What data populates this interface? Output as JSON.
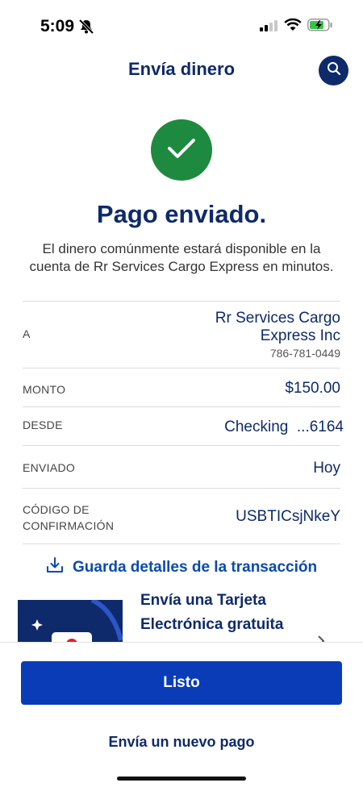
{
  "status": {
    "time": "5:09"
  },
  "header": {
    "title": "Envía dinero"
  },
  "confirmation": {
    "title": "Pago enviado.",
    "message": "El dinero comúnmente estará disponible en la cuenta de Rr Services Cargo Express en minutos."
  },
  "details": {
    "a_label": "A",
    "recipient_line1": "Rr Services Cargo",
    "recipient_line2": "Express Inc",
    "recipient_phone": "786-781-0449",
    "monto_label": "MONTO",
    "monto_value": "$150.00",
    "desde_label": "DESDE",
    "desde_value": "Checking  ...6164",
    "enviado_label": "ENVIADO",
    "enviado_value": "Hoy",
    "codigo_label_1": "CÓDIGO DE",
    "codigo_label_2": "CONFIRMACIÓN",
    "codigo_value": "USBTICsjNkeY"
  },
  "save_link": "Guarda detalles de la transacción",
  "promo": {
    "line1": "Envía una Tarjeta",
    "line2": "Electrónica gratuita"
  },
  "footer": {
    "done_label": "Listo",
    "new_payment_label": "Envía un nuevo pago"
  },
  "icons": {
    "search": "search-icon",
    "check": "checkmark-icon",
    "download": "download-icon",
    "chevron": "chevron-right-icon",
    "bell": "bell-slash-icon"
  },
  "colors": {
    "brand_navy": "#0e2a6b",
    "primary_blue": "#0a3cb8",
    "success_green": "#1e8a3f"
  }
}
